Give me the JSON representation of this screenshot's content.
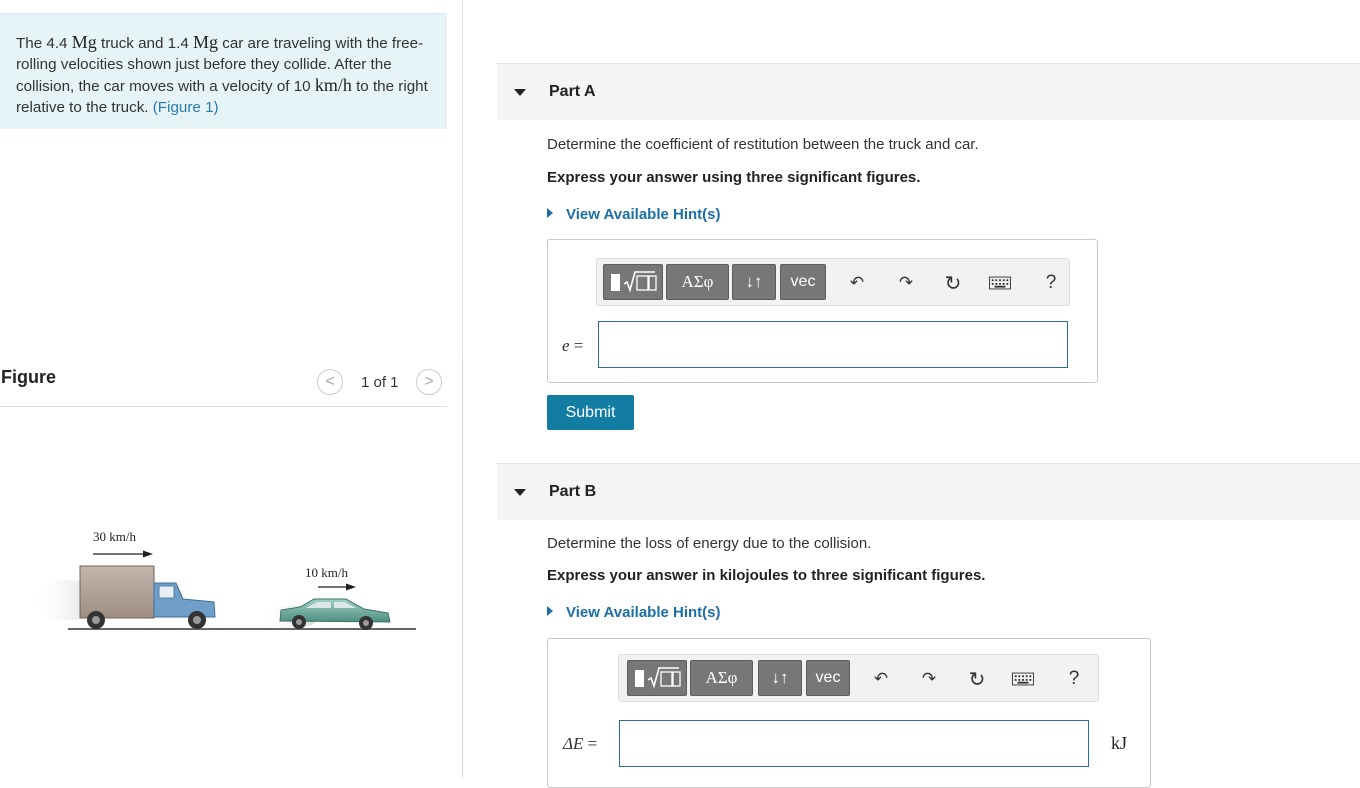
{
  "problem": {
    "text_1": "The 4.4 ",
    "unit_mg": "Mg",
    "text_2": " truck and 1.4 ",
    "text_3": " car are traveling with the free-rolling velocities shown just before they collide. After the collision, the car moves with a velocity of 10 ",
    "unit_kmh": "km/h",
    "text_4": " to the right relative to the truck. ",
    "figure_link": "(Figure 1)"
  },
  "figure": {
    "title": "Figure",
    "prev_icon": "chevron-left-icon",
    "next_icon": "chevron-right-icon",
    "prev_glyph": "<",
    "next_glyph": ">",
    "count": "1 of 1",
    "truck_velocity": "30 km/h",
    "car_velocity": "10 km/h"
  },
  "parts": [
    {
      "title": "Part A",
      "question": "Determine the coefficient of restitution between the truck and car.",
      "instruction": "Express your answer using three significant figures.",
      "hint": "View Available Hint(s)",
      "variable": "e",
      "equals": "=",
      "input_value": "",
      "submit_label": "Submit"
    },
    {
      "title": "Part B",
      "question": "Determine the loss of energy due to the collision.",
      "instruction": "Express your answer in kilojoules to three significant figures.",
      "hint": "View Available Hint(s)",
      "variable": "ΔE",
      "equals": "=",
      "input_value": "",
      "units": "kJ"
    }
  ],
  "toolbar": {
    "greek_label": "ΑΣφ",
    "arrows_label": "↓↑",
    "vec_label": "vec",
    "help_label": "?",
    "undo_glyph": "↶",
    "redo_glyph": "↷",
    "reset_glyph": "↻",
    "icons": [
      "templates-icon",
      "greek-letters-icon",
      "arrows-icon",
      "vec-icon",
      "undo-icon",
      "redo-icon",
      "reset-icon",
      "keyboard-icon",
      "help-icon"
    ]
  },
  "colors": {
    "problem_bg": "#e6f4f7",
    "link": "#2a7ab0",
    "hint": "#1c6fa6",
    "submit_bg": "#127ca3",
    "input_border": "#2c6e8f",
    "toolbar_button": "#777777"
  }
}
